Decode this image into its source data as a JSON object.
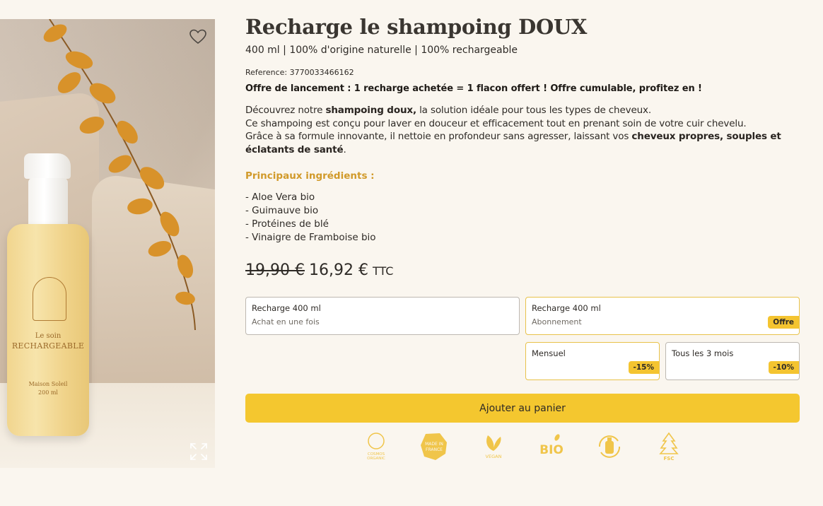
{
  "product": {
    "title": "Recharge le shampoing DOUX",
    "subtitle": "400 ml | 100% d'origine naturelle | 100% rechargeable",
    "reference": "Reference: 3770033466162",
    "promo": "Offre de lancement : 1 recharge achetée = 1 flacon offert ! Offre cumulable, profitez en !",
    "description": {
      "p1_pre": "Découvrez notre ",
      "p1_bold": "shampoing doux,",
      "p1_post": " la solution idéale pour tous les types de cheveux.",
      "p2": "Ce shampoing est conçu pour laver en douceur et efficacement tout en prenant soin de votre cuir chevelu.",
      "p3_pre": "Grâce à sa formule innovante, il nettoie en profondeur sans agresser, laissant vos ",
      "p3_bold": "cheveux propres, souples et éclatants de santé",
      "p3_post": "."
    },
    "ingredients_title": "Principaux ingrédients :",
    "ingredients": [
      "- Aloe Vera bio",
      "- Guimauve bio",
      "- Protéines de blé",
      "- Vinaigre de Framboise bio"
    ],
    "price": {
      "old": "19,90 €",
      "new": "16,92 €",
      "suffix": "TTC"
    }
  },
  "image": {
    "label_line1": "Le soin",
    "label_line2": "RECHARGEABLE",
    "brand": "Maison Soleil",
    "volume": "200 ml"
  },
  "options": {
    "one_time": {
      "title": "Recharge 400 ml",
      "subtitle": "Achat en une fois"
    },
    "subscription": {
      "title": "Recharge 400 ml",
      "subtitle": "Abonnement",
      "badge": "Offre"
    },
    "monthly": {
      "title": "Mensuel",
      "badge": "-15%"
    },
    "quarterly": {
      "title": "Tous les 3 mois",
      "badge": "-10%"
    }
  },
  "cart_button": "Ajouter au panier",
  "certifications": [
    {
      "icon": "cosmos-organic-icon",
      "text": "COSMOS ORGANIC"
    },
    {
      "icon": "made-in-france-icon",
      "text": "MADE IN FRANCE"
    },
    {
      "icon": "vegan-icon",
      "text": "VEGAN"
    },
    {
      "icon": "bio-icon",
      "text": "BIO"
    },
    {
      "icon": "recharge-icon",
      "text": ""
    },
    {
      "icon": "fsc-icon",
      "text": "FSC"
    }
  ],
  "colors": {
    "accent": "#f4c72f",
    "ingredient_title": "#d19a2a",
    "background": "#faf6ef"
  }
}
